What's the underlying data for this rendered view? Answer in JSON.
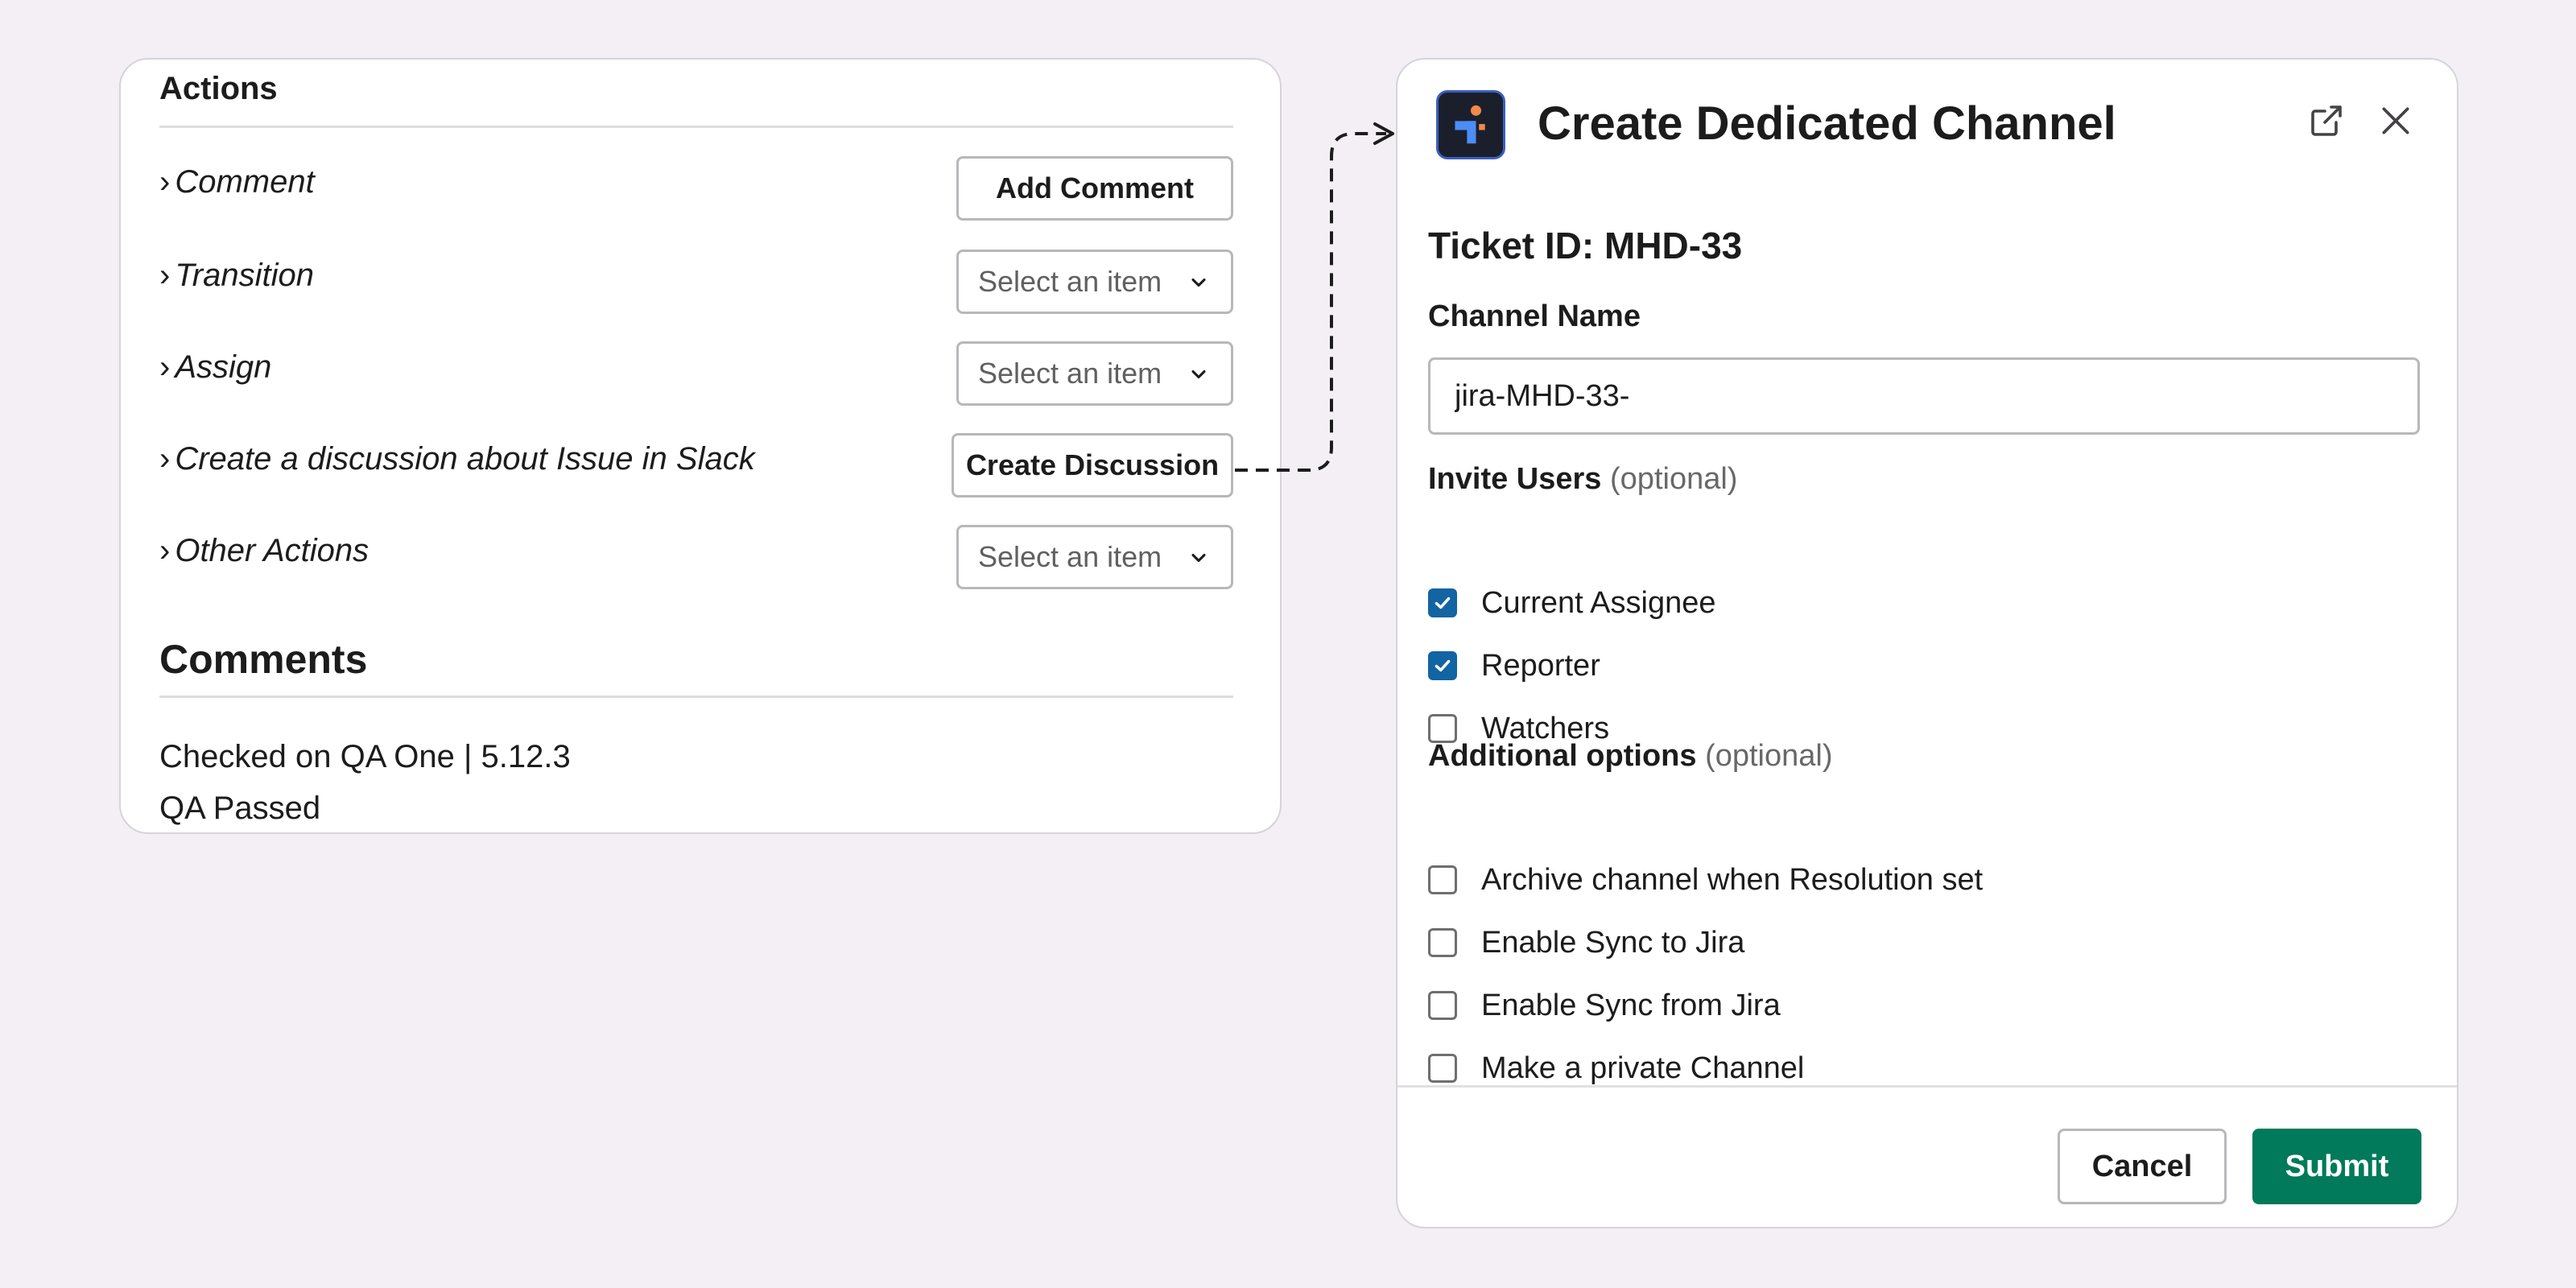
{
  "actions_panel": {
    "title": "Actions",
    "rows": [
      {
        "label": "Comment",
        "control": "button",
        "button_label": "Add Comment"
      },
      {
        "label": "Transition",
        "control": "select",
        "select_value": "Select an item"
      },
      {
        "label": "Assign",
        "control": "select",
        "select_value": "Select an item"
      },
      {
        "label": "Create a discussion about Issue in Slack",
        "control": "button",
        "button_label": "Create Discussion"
      },
      {
        "label": "Other Actions",
        "control": "select",
        "select_value": "Select an item"
      }
    ],
    "chevron": "›"
  },
  "comments_panel": {
    "title": "Comments",
    "lines": [
      "Checked on QA One | 5.12.3",
      "QA Passed"
    ]
  },
  "modal": {
    "title": "Create Dedicated Channel",
    "ticket_id": "Ticket ID: MHD-33",
    "channel_name_label": "Channel Name",
    "channel_name_value": "jira-MHD-33-",
    "invite_users": {
      "label": "Invite Users",
      "optional": "(optional)",
      "options": [
        {
          "label": "Current Assignee",
          "checked": true
        },
        {
          "label": "Reporter",
          "checked": true
        },
        {
          "label": "Watchers",
          "checked": false
        }
      ]
    },
    "additional_options": {
      "label": "Additional options",
      "optional": "(optional)",
      "options": [
        {
          "label": "Archive channel when Resolution set",
          "checked": false
        },
        {
          "label": "Enable Sync to Jira",
          "checked": false
        },
        {
          "label": "Enable Sync from Jira",
          "checked": false
        },
        {
          "label": "Make a private Channel",
          "checked": false
        }
      ]
    },
    "cancel_label": "Cancel",
    "submit_label": "Submit"
  },
  "icons": {
    "app_logo": "app-logo-icon",
    "external_link": "external-link-icon",
    "close": "close-icon",
    "dropdown": "chevron-down-icon",
    "checkmark": "checkmark-icon"
  },
  "colors": {
    "background": "#f3eff5",
    "checkbox_checked": "#1264a3",
    "submit": "#007a5a",
    "logo_bg": "#1b1f2c",
    "logo_orange": "#f08a4b",
    "logo_blue": "#4c8df6"
  }
}
